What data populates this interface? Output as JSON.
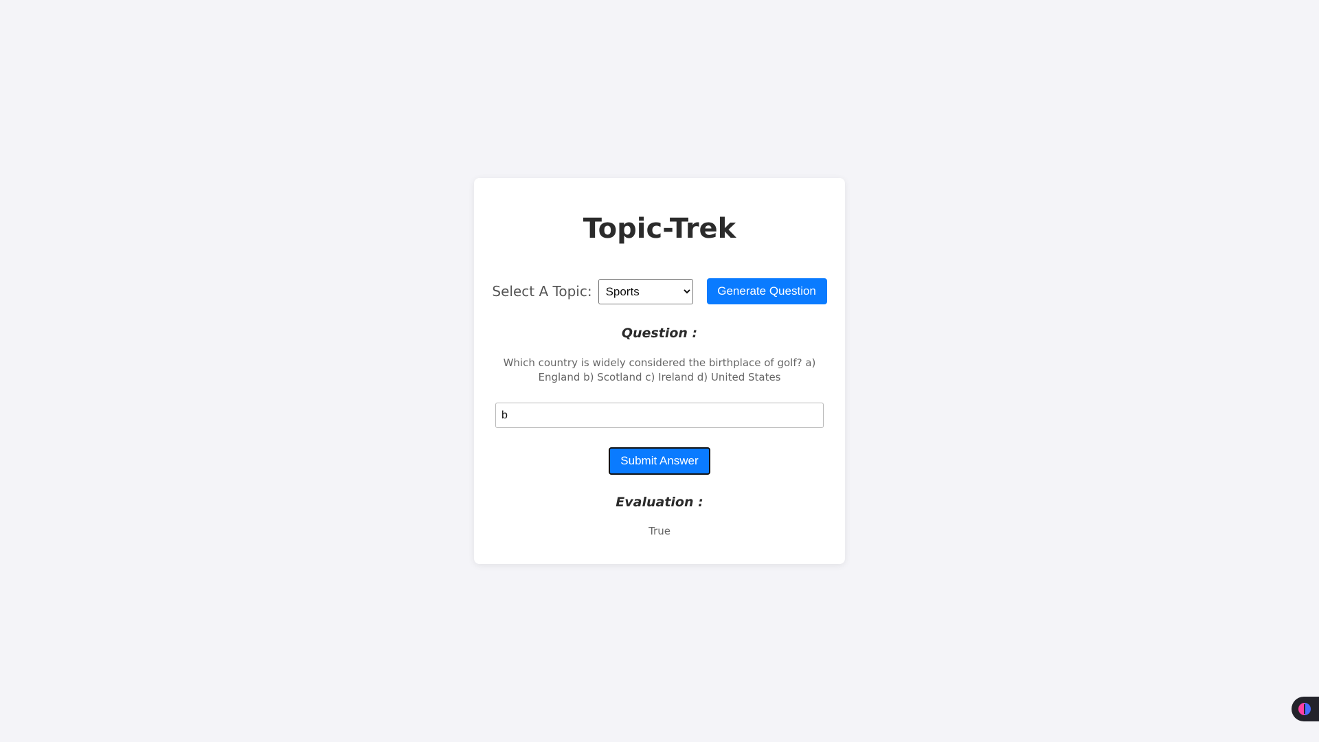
{
  "app": {
    "title": "Topic-Trek"
  },
  "topic_selector": {
    "label": "Select A Topic:",
    "selected": "Sports",
    "options": [
      "Sports"
    ]
  },
  "buttons": {
    "generate_label": "Generate Question",
    "submit_label": "Submit Answer"
  },
  "question": {
    "heading": "Question :",
    "text": "Which country is widely considered the birthplace of golf? a) England b) Scotland c) Ireland d) United States"
  },
  "answer": {
    "value": "b"
  },
  "evaluation": {
    "heading": "Evaluation :",
    "result": "True"
  },
  "extension": {
    "icon": "brain-icon"
  },
  "colors": {
    "accent": "#0a7bff",
    "background": "#f4f4f8",
    "card": "#ffffff"
  }
}
